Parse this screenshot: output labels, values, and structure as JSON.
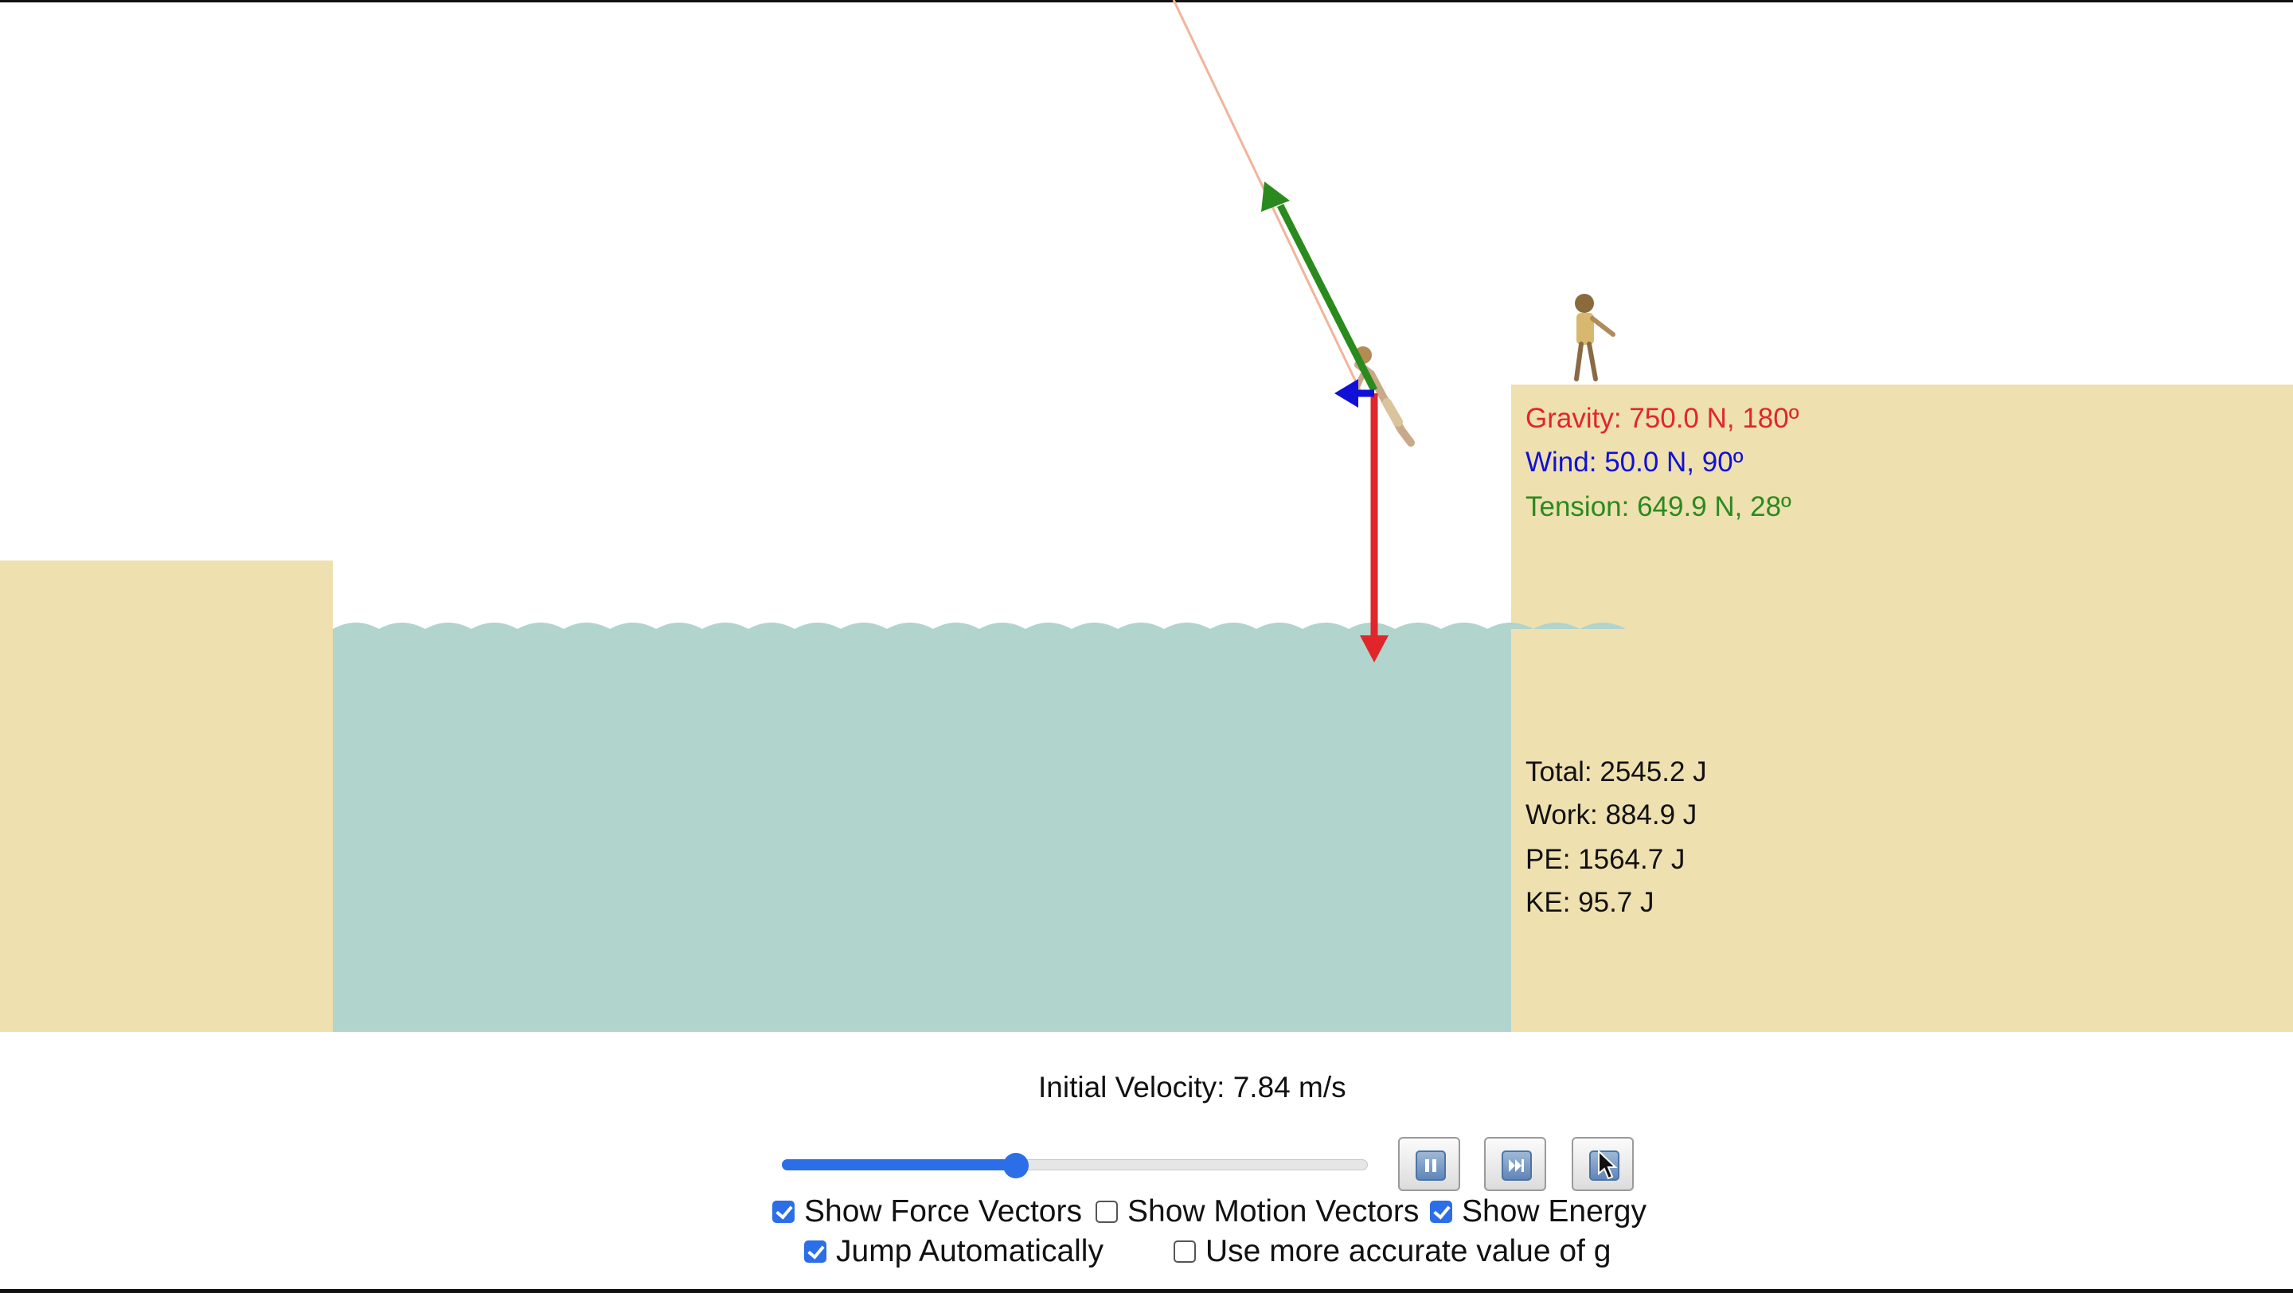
{
  "readouts": {
    "gravity": "Gravity: 750.0 N, 180º",
    "wind": "Wind: 50.0 N, 90º",
    "tension": "Tension: 649.9 N, 28º",
    "total": "Total: 2545.2 J",
    "work": "Work: 884.9 J",
    "pe": "PE: 1564.7 J",
    "ke": "KE: 95.7 J"
  },
  "colors": {
    "gravity": "#e0262b",
    "wind": "#1010d8",
    "tension": "#2a8a1e",
    "sand": "#efe0b0",
    "water": "#b1d4cd",
    "rope": "#f2b49a",
    "slider_accent": "#2b6ee8"
  },
  "controls": {
    "velocity_label": "Initial Velocity: 7.84 m/s",
    "velocity_fraction": 0.4,
    "buttons": [
      {
        "name": "pause",
        "icon": "pause-icon"
      },
      {
        "name": "step",
        "icon": "step-forward-icon"
      },
      {
        "name": "reset",
        "icon": "reset-icon"
      }
    ],
    "checkboxes": {
      "show_force_vectors": {
        "label": "Show Force Vectors",
        "checked": true
      },
      "show_motion_vectors": {
        "label": "Show Motion Vectors",
        "checked": false
      },
      "show_energy": {
        "label": "Show Energy",
        "checked": true
      },
      "jump_automatically": {
        "label": "Jump Automatically",
        "checked": true
      },
      "accurate_g": {
        "label": "Use more accurate value of g",
        "checked": false
      }
    }
  }
}
